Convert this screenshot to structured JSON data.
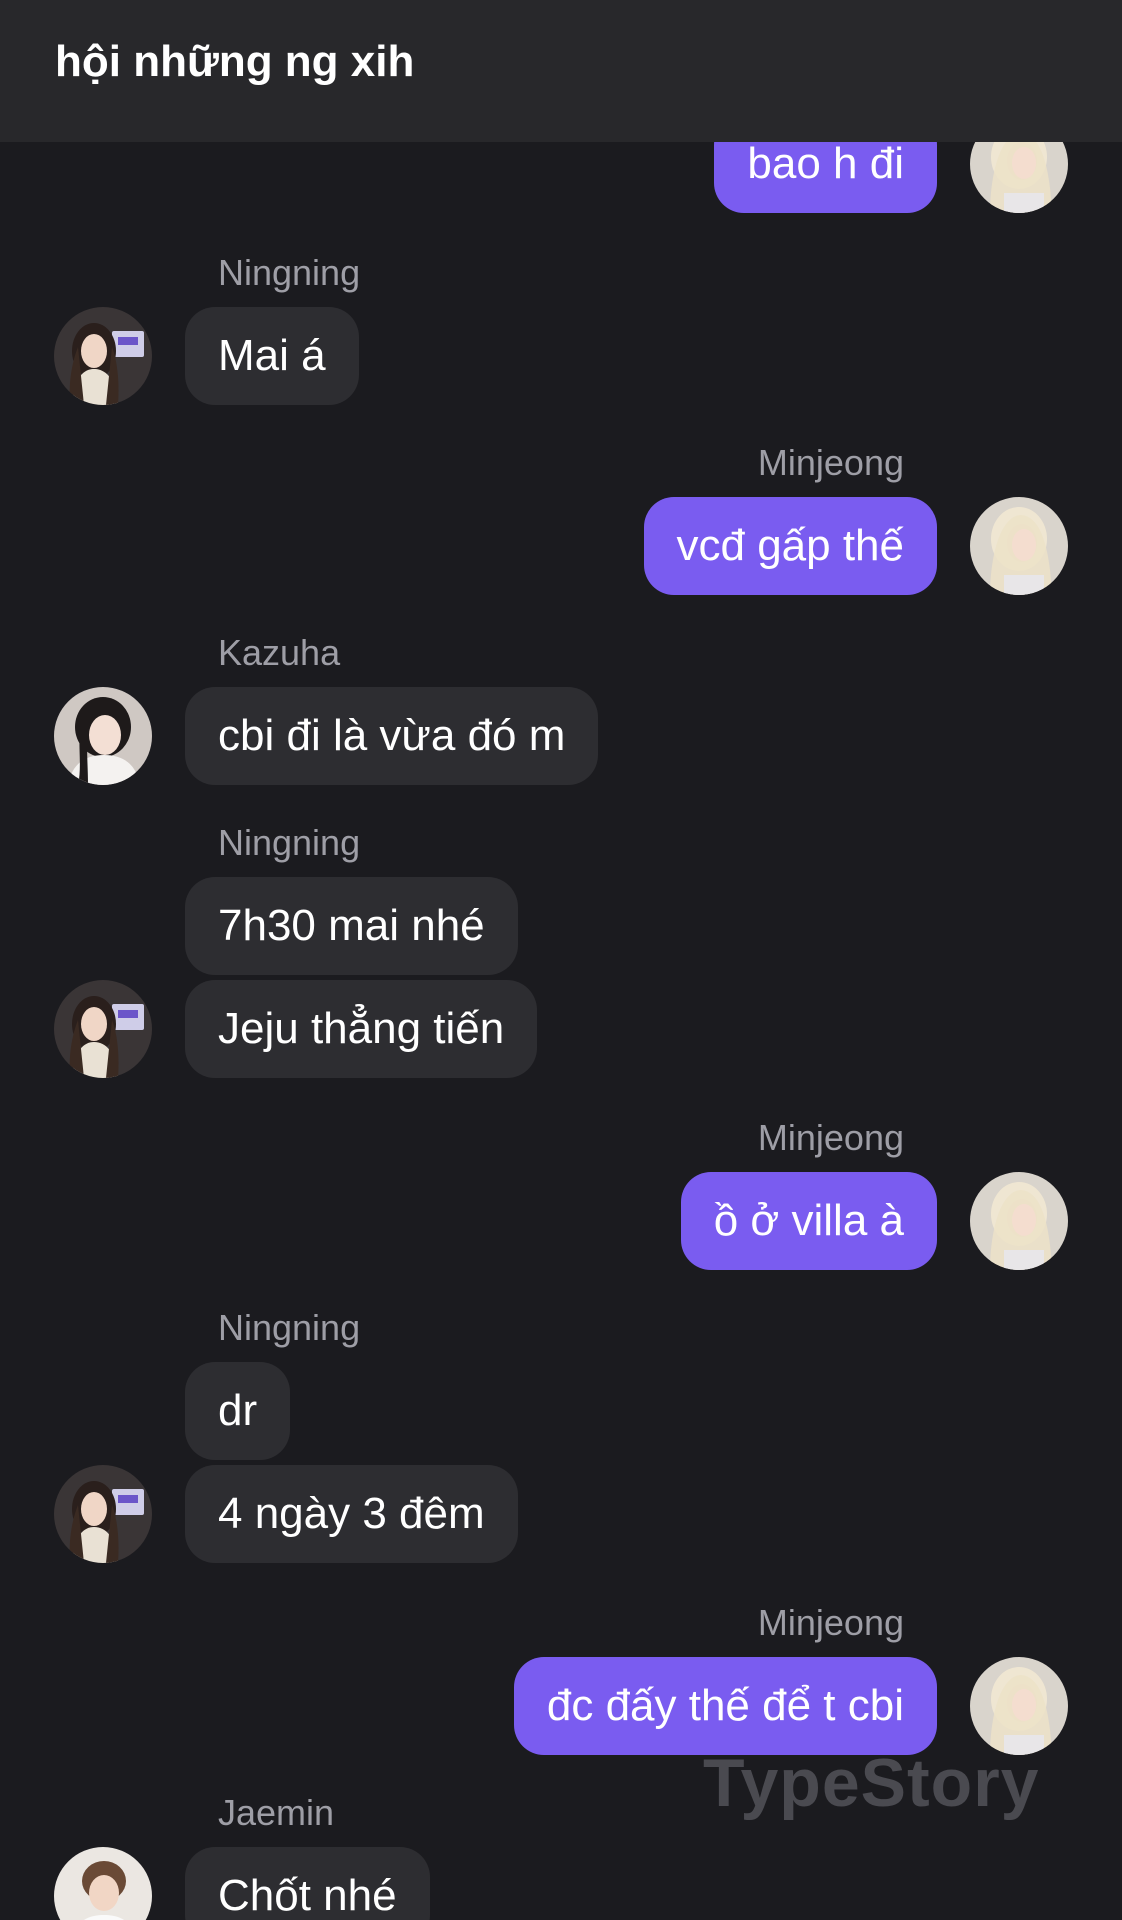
{
  "header": {
    "title": "hội những ng xih"
  },
  "watermark": "TypeStory",
  "messages": [
    {
      "sender": "",
      "text": "bao h đi",
      "direction": "out",
      "avatar": "minjeong-avatar"
    },
    {
      "sender": "Ningning",
      "text": "Mai á",
      "direction": "in",
      "avatar": "ningning-avatar"
    },
    {
      "sender": "Minjeong",
      "text": "vcđ gấp thế",
      "direction": "out",
      "avatar": "minjeong-avatar"
    },
    {
      "sender": "Kazuha",
      "text": "cbi đi là vừa đó m",
      "direction": "in",
      "avatar": "kazuha-avatar"
    },
    {
      "sender": "Ningning",
      "text": "7h30 mai nhé",
      "direction": "in",
      "avatar": ""
    },
    {
      "sender": "",
      "text": "Jeju thẳng tiến",
      "direction": "in",
      "avatar": "ningning-avatar"
    },
    {
      "sender": "Minjeong",
      "text": "ồ ở villa à",
      "direction": "out",
      "avatar": "minjeong-avatar"
    },
    {
      "sender": "Ningning",
      "text": "dr",
      "direction": "in",
      "avatar": ""
    },
    {
      "sender": "",
      "text": "4 ngày 3 đêm",
      "direction": "in",
      "avatar": "ningning-avatar"
    },
    {
      "sender": "Minjeong",
      "text": "đc đấy thế để t cbi",
      "direction": "out",
      "avatar": "minjeong-avatar"
    },
    {
      "sender": "Jaemin",
      "text": "Chốt nhé",
      "direction": "in",
      "avatar": "jaemin-avatar"
    }
  ],
  "colors": {
    "background": "#1b1b1f",
    "header": "#28282b",
    "incoming_bubble": "#2d2d31",
    "outgoing_bubble": "#7a5cf0",
    "sender_name": "#9e9ea6"
  }
}
